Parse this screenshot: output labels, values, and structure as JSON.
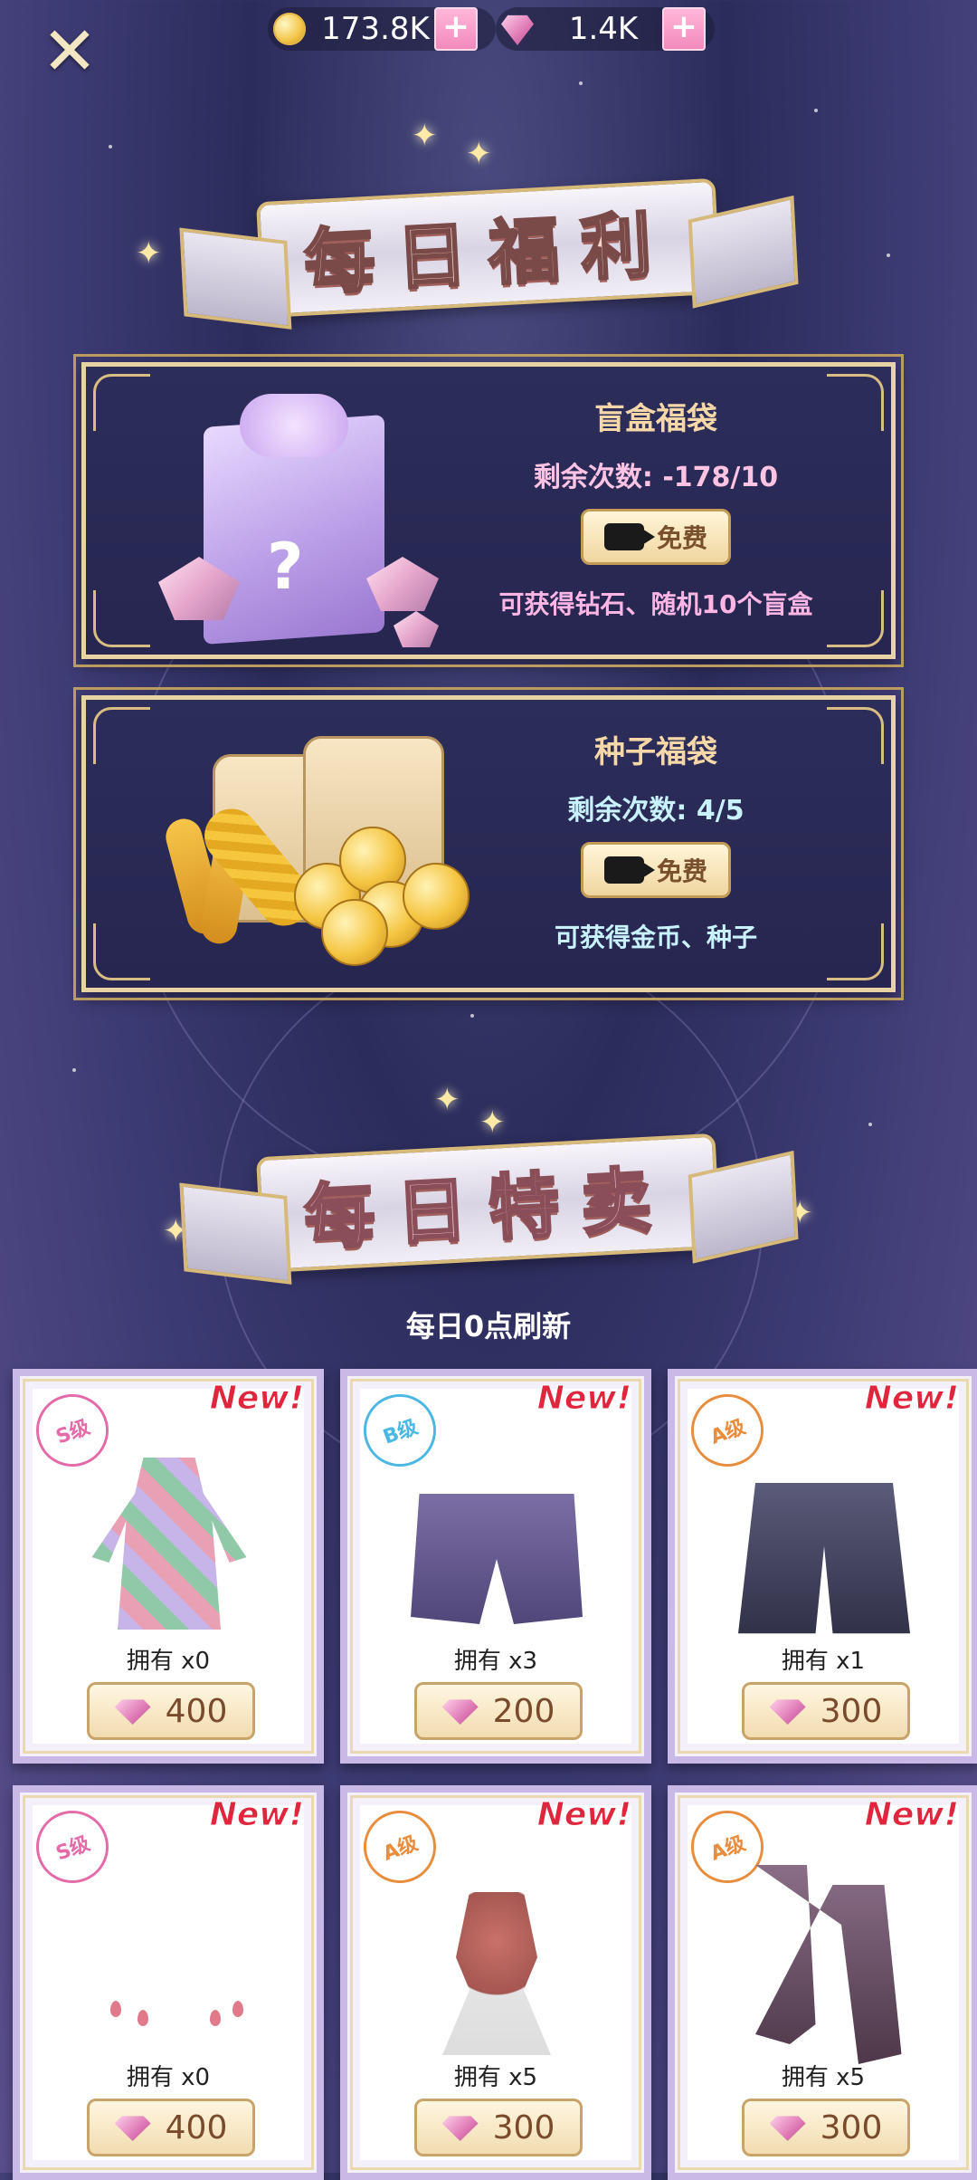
{
  "topbar": {
    "close_icon": "close-icon",
    "coins": "173.8K",
    "gems": "1.4K",
    "plus": "+"
  },
  "daily_welfare": {
    "title": "每日福利",
    "cards": [
      {
        "title": "盲盒福袋",
        "remaining": "剩余次数: -178/10",
        "button": "免费",
        "reward": "可获得钻石、随机10个盲盒"
      },
      {
        "title": "种子福袋",
        "remaining": "剩余次数: 4/5",
        "button": "免费",
        "reward": "可获得金币、种子"
      }
    ]
  },
  "daily_sale": {
    "title": "每日特卖",
    "refresh": "每日0点刷新",
    "items": [
      {
        "new": "New!",
        "grade": "S级",
        "owned": "拥有 x0",
        "price": "400"
      },
      {
        "new": "New!",
        "grade": "B级",
        "owned": "拥有 x3",
        "price": "200"
      },
      {
        "new": "New!",
        "grade": "A级",
        "owned": "拥有 x1",
        "price": "300"
      },
      {
        "new": "New!",
        "grade": "S级",
        "owned": "拥有 x0",
        "price": "400"
      },
      {
        "new": "New!",
        "grade": "A级",
        "owned": "拥有 x5",
        "price": "300"
      },
      {
        "new": "New!",
        "grade": "A级",
        "owned": "拥有 x5",
        "price": "300"
      }
    ]
  },
  "colors": {
    "accent_gold": "#e8d3a4",
    "new_red": "#e0263c",
    "bg": "#2c2c5c"
  }
}
